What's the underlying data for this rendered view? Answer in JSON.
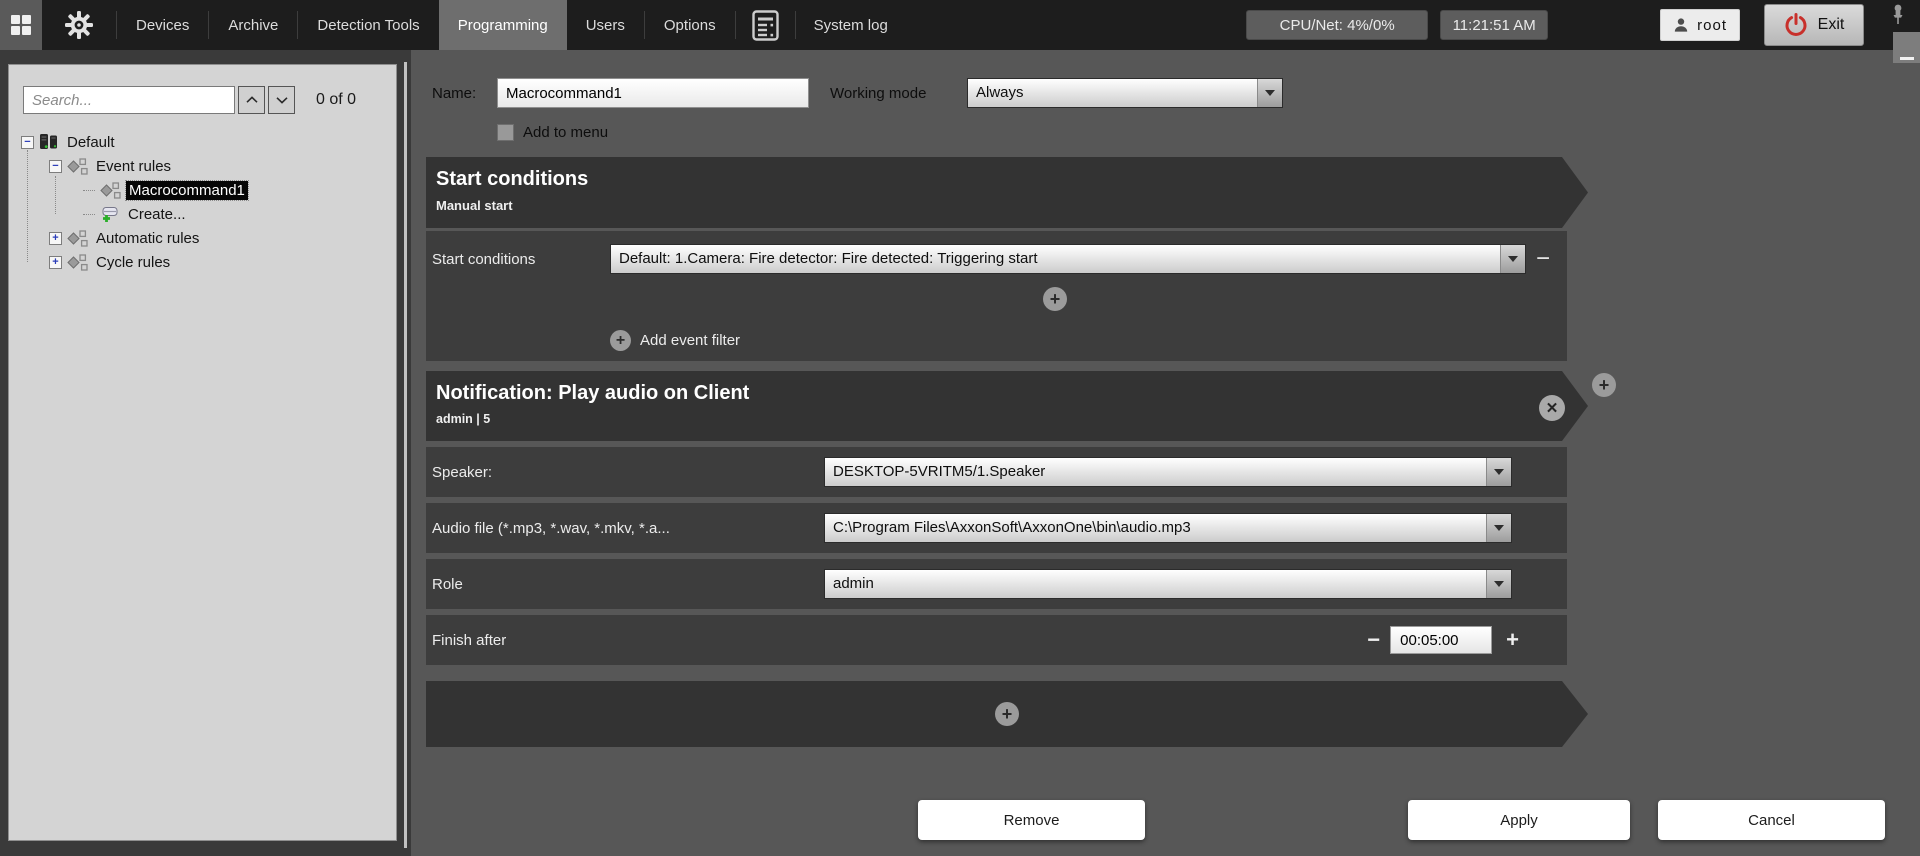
{
  "topbar": {
    "menu": [
      {
        "label": "Devices",
        "active": false
      },
      {
        "label": "Archive",
        "active": false
      },
      {
        "label": "Detection Tools",
        "active": false
      },
      {
        "label": "Programming",
        "active": true
      },
      {
        "label": "Users",
        "active": false
      },
      {
        "label": "Options",
        "active": false
      }
    ],
    "system_log_label": "System log",
    "cpu_net": "CPU/Net: 4%/0%",
    "time": "11:21:51 AM",
    "user": "root",
    "exit_label": "Exit"
  },
  "sidebar": {
    "search_placeholder": "Search...",
    "counter": "0 of 0",
    "tree": [
      {
        "label": "Default",
        "level": 0,
        "icon": "server-stack",
        "expander": "−",
        "selected": false
      },
      {
        "label": "Event rules",
        "level": 1,
        "icon": "flowchart-diamond",
        "expander": "−",
        "selected": false
      },
      {
        "label": "Macrocommand1",
        "level": 2,
        "icon": "flowchart-diamond",
        "expander": null,
        "selected": true
      },
      {
        "label": "Create...",
        "level": 2,
        "icon": "node-plus",
        "expander": null,
        "selected": false
      },
      {
        "label": "Automatic rules",
        "level": 1,
        "icon": "flowchart-diamond",
        "expander": "+",
        "selected": false
      },
      {
        "label": "Cycle rules",
        "level": 1,
        "icon": "flowchart-diamond",
        "expander": "+",
        "selected": false
      }
    ]
  },
  "editor": {
    "name_label": "Name:",
    "name_value": "Macrocommand1",
    "working_mode_label": "Working mode",
    "working_mode_value": "Always",
    "add_to_menu_label": "Add to menu",
    "start_section": {
      "title": "Start conditions",
      "subtitle": "Manual start",
      "row_label": "Start conditions",
      "row_value": "Default: 1.Camera: Fire detector: Fire detected: Triggering start",
      "add_event_filter_label": "Add event filter"
    },
    "action_section": {
      "title": "Notification: Play audio on Client",
      "subtitle": "admin | 5",
      "rows": [
        {
          "label": "Speaker:",
          "value": "DESKTOP-5VRITM5/1.Speaker",
          "type": "dropdown"
        },
        {
          "label": "Audio file (*.mp3, *.wav, *.mkv, *.a...",
          "value": "C:\\Program Files\\AxxonSoft\\AxxonOne\\bin\\audio.mp3",
          "type": "dropdown"
        },
        {
          "label": "Role",
          "value": "admin",
          "type": "dropdown"
        },
        {
          "label": "Finish after",
          "value": "00:05:00",
          "type": "spinner"
        }
      ]
    },
    "buttons": {
      "remove": "Remove",
      "apply": "Apply",
      "cancel": "Cancel"
    }
  },
  "icons": {
    "apps-grid": "grid-2x2 squares",
    "settings-gear": "gear",
    "system-log": "document with list lines",
    "user": "person silhouette",
    "exit-power": "power symbol",
    "pin": "pushpin",
    "search-prev": "chevron-up",
    "search-next": "chevron-down",
    "tree-server": "server stack with green leds",
    "tree-rule": "diamond with linked squares",
    "tree-create": "node with green plus",
    "dropdown-arrow": "triangle-down",
    "add": "plus in circle",
    "close": "x in circle",
    "minus": "−",
    "plus": "+"
  },
  "colors": {
    "topbar_bg": "#1d1d1d",
    "active_tab_bg": "#6e6e6e",
    "panel_bg": "#575757",
    "banner_bg": "#333333",
    "row_bg": "#3d3d3d",
    "sidebar_bg": "#d4d4d4",
    "selected_tree_bg": "#060606",
    "accent_red": "#c8302b",
    "create_green": "#2aae2a",
    "expander_blue": "#2a3cb8"
  }
}
